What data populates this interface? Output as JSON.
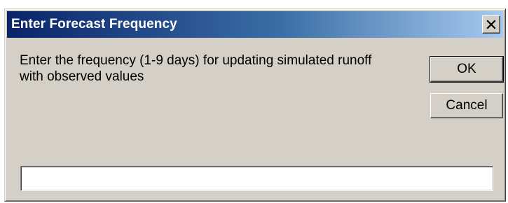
{
  "dialog": {
    "title": "Enter Forecast Frequency",
    "prompt": "Enter the frequency (1-9 days) for updating simulated runoff with observed values",
    "ok_label": "OK",
    "cancel_label": "Cancel",
    "input_value": "",
    "close_icon": "close-x-icon"
  },
  "colors": {
    "titlebar_start": "#0a246a",
    "titlebar_end": "#a6caf0",
    "face": "#d4d0c8"
  }
}
